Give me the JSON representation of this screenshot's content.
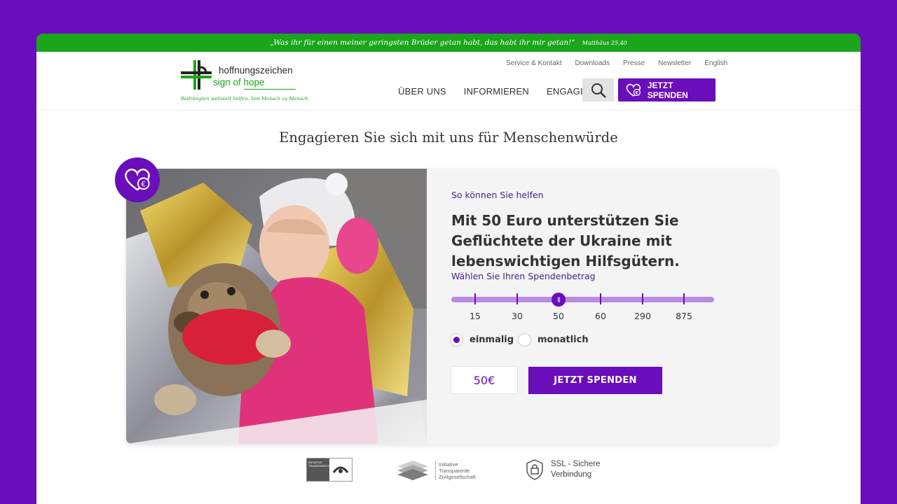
{
  "quote": {
    "text": "„Was ihr für einen meiner geringsten Brüder getan habt, das habt ihr mir getan!“",
    "reference": "Matthäus 25,40"
  },
  "logo": {
    "line1": "hoffnungszeichen",
    "line2": "sign of hope",
    "tagline": "Bedrängten weltweit helfen. Von Mensch zu Mensch."
  },
  "top_nav": [
    "Service & Kontakt",
    "Downloads",
    "Presse",
    "Newsletter",
    "English"
  ],
  "main_nav": [
    "ÜBER UNS",
    "INFORMIEREN",
    "ENGAGIEREN"
  ],
  "header_donate_label": "JETZT SPENDEN",
  "headline": "Engagieren Sie sich mit uns für Menschenwürde",
  "donation": {
    "eyebrow": "So können Sie helfen",
    "title": "Mit 50 Euro unterstützen Sie Geflüchtete der Ukraine mit lebenswichtigen Hilfsgütern.",
    "slider_label": "Wählen Sie Ihren Spendenbetrag",
    "amounts": [
      "15",
      "30",
      "50",
      "60",
      "290",
      "875"
    ],
    "selected_amount": "50",
    "frequency_options": [
      "einmalig",
      "monatlich"
    ],
    "selected_frequency": "einmalig",
    "amount_value": "50€",
    "submit_label": "JETZT SPENDEN"
  },
  "trust": {
    "badge1_text": "INITIATIVE TRANSPARENTE",
    "badge2_lines": [
      "Initiative",
      "Transparente",
      "Zivilgesellschaft"
    ],
    "ssl_lines": [
      "SSL - Sichere",
      "Verbindung"
    ]
  },
  "colors": {
    "brand_purple": "#6a0dba",
    "brand_green": "#1aa51a",
    "slider_track": "#b98ce0"
  }
}
